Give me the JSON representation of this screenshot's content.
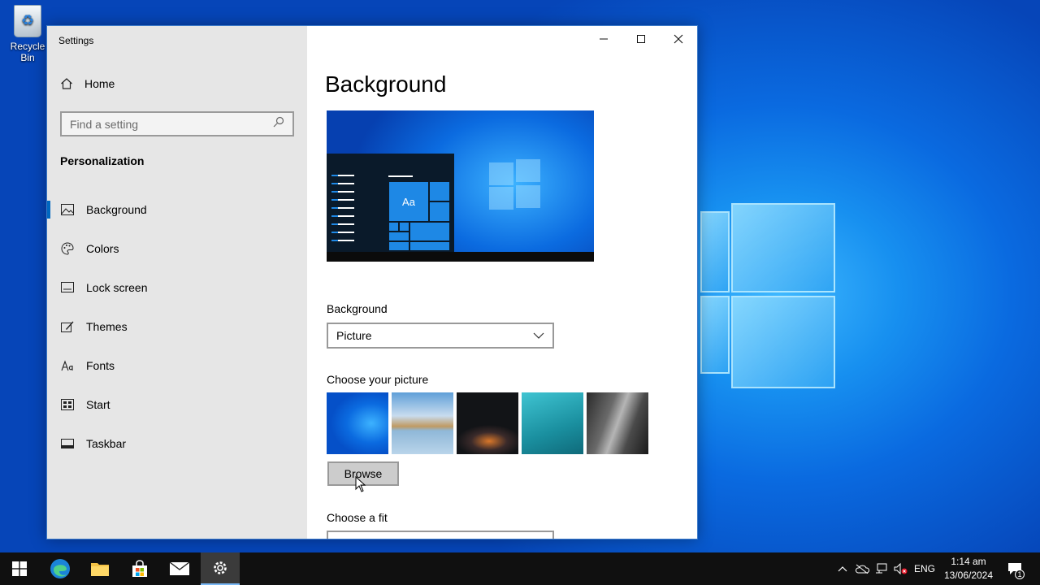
{
  "desktop": {
    "recycle_bin_label": "Recycle Bin"
  },
  "window": {
    "title": "Settings"
  },
  "sidebar": {
    "home_label": "Home",
    "search_placeholder": "Find a setting",
    "section_title": "Personalization",
    "items": [
      {
        "label": "Background",
        "icon": "picture-icon",
        "active": true
      },
      {
        "label": "Colors",
        "icon": "palette-icon",
        "active": false
      },
      {
        "label": "Lock screen",
        "icon": "lock-screen-icon",
        "active": false
      },
      {
        "label": "Themes",
        "icon": "brush-icon",
        "active": false
      },
      {
        "label": "Fonts",
        "icon": "font-icon",
        "active": false
      },
      {
        "label": "Start",
        "icon": "start-icon",
        "active": false
      },
      {
        "label": "Taskbar",
        "icon": "taskbar-icon",
        "active": false
      }
    ]
  },
  "main": {
    "page_title": "Background",
    "preview_tile_text": "Aa",
    "background_label": "Background",
    "background_value": "Picture",
    "choose_picture_label": "Choose your picture",
    "browse_label": "Browse",
    "choose_fit_label": "Choose a fit"
  },
  "taskbar": {
    "apps": [
      "start-icon",
      "edge-icon",
      "file-explorer-icon",
      "store-icon",
      "mail-icon",
      "settings-icon"
    ],
    "language": "ENG",
    "time": "1:14 am",
    "date": "13/06/2024",
    "notification_count": "1"
  },
  "colors": {
    "accent": "#0067c0",
    "sidebar_bg": "#e6e6e6",
    "taskbar_bg": "#101010"
  }
}
